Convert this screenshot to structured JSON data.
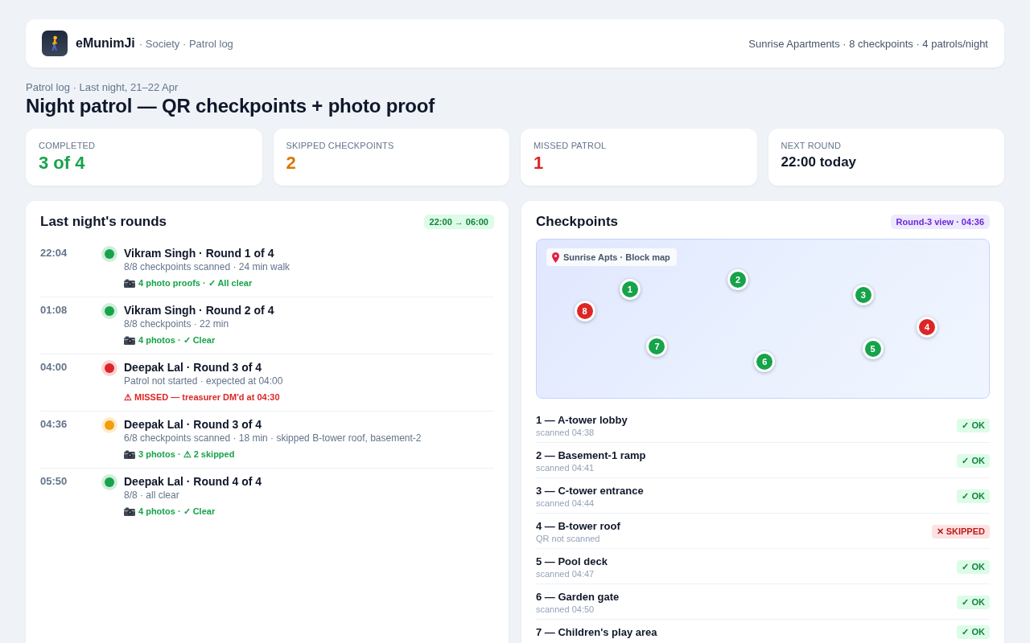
{
  "header": {
    "brand": "eMunimJi",
    "crumbs": "· Society · Patrol log",
    "summary": "Sunrise Apartments · 8 checkpoints · 4 patrols/night"
  },
  "page": {
    "eyebrow": "Patrol log · Last night, 21–22 Apr",
    "title": "Night patrol — QR checkpoints + photo proof"
  },
  "stats": [
    {
      "label": "COMPLETED",
      "value": "3 of 4",
      "kind": "count",
      "color": "#16a34a"
    },
    {
      "label": "SKIPPED CHECKPOINTS",
      "value": "2",
      "kind": "count",
      "color": "#d97706"
    },
    {
      "label": "MISSED PATROL",
      "value": "1",
      "kind": "count",
      "color": "#dc2626"
    },
    {
      "label": "NEXT ROUND",
      "value": "22:00 today",
      "kind": "time"
    }
  ],
  "rounds_panel": {
    "title": "Last night's rounds",
    "badge": "22:00 → 06:00",
    "rounds": [
      {
        "time": "22:04",
        "color": "#16a34a",
        "title": "Vikram Singh · Round 1 of 4",
        "detail": "8/8 checkpoints scanned · 24 min walk",
        "note": {
          "kind": "proof",
          "text": "4 photo proofs · ✓ All clear"
        }
      },
      {
        "time": "01:08",
        "color": "#16a34a",
        "title": "Vikram Singh · Round 2 of 4",
        "detail": "8/8 checkpoints · 22 min",
        "note": {
          "kind": "proof",
          "text": "4 photos · ✓ Clear"
        }
      },
      {
        "time": "04:00",
        "color": "#dc2626",
        "title": "Deepak Lal · Round 3 of 4",
        "detail": "Patrol not started · expected at 04:00",
        "note": {
          "kind": "alert",
          "text": "⚠ MISSED — treasurer DM'd at 04:30"
        }
      },
      {
        "time": "04:36",
        "color": "#f59e0b",
        "title": "Deepak Lal · Round 3 of 4",
        "detail": "6/8 checkpoints scanned · 18 min · skipped B-tower roof, basement-2",
        "note": {
          "kind": "proof",
          "text": "3 photos · ⚠ 2 skipped"
        }
      },
      {
        "time": "05:50",
        "color": "#16a34a",
        "title": "Deepak Lal · Round 4 of 4",
        "detail": "8/8 · all clear",
        "note": {
          "kind": "proof",
          "text": "4 photos · ✓ Clear"
        }
      }
    ]
  },
  "checkpoints_panel": {
    "title": "Checkpoints",
    "badge": "Round-3 view · 04:36",
    "map": {
      "label": "Sunrise Apts · Block map",
      "markers": [
        {
          "label": "1",
          "color": "#16a34a"
        },
        {
          "label": "2",
          "color": "#16a34a"
        },
        {
          "label": "3",
          "color": "#16a34a"
        },
        {
          "label": "4",
          "color": "#dc2626"
        },
        {
          "label": "5",
          "color": "#16a34a"
        },
        {
          "label": "6",
          "color": "#16a34a"
        },
        {
          "label": "7",
          "color": "#16a34a"
        },
        {
          "label": "8",
          "color": "#dc2626"
        }
      ]
    },
    "items": [
      {
        "name": "1 — A-tower lobby",
        "detail": "scanned 04:38",
        "kind": "ok",
        "badge": "✓ OK"
      },
      {
        "name": "2 — Basement-1 ramp",
        "detail": "scanned 04:41",
        "kind": "ok",
        "badge": "✓ OK"
      },
      {
        "name": "3 — C-tower entrance",
        "detail": "scanned 04:44",
        "kind": "ok",
        "badge": "✓ OK"
      },
      {
        "name": "4 — B-tower roof",
        "detail": "QR not scanned",
        "kind": "skipped",
        "badge": "✕ SKIPPED"
      },
      {
        "name": "5 — Pool deck",
        "detail": "scanned 04:47",
        "kind": "ok",
        "badge": "✓ OK"
      },
      {
        "name": "6 — Garden gate",
        "detail": "scanned 04:50",
        "kind": "ok",
        "badge": "✓ OK"
      },
      {
        "name": "7 — Children's play area",
        "kind": "ok",
        "badge": "✓ OK"
      }
    ]
  }
}
